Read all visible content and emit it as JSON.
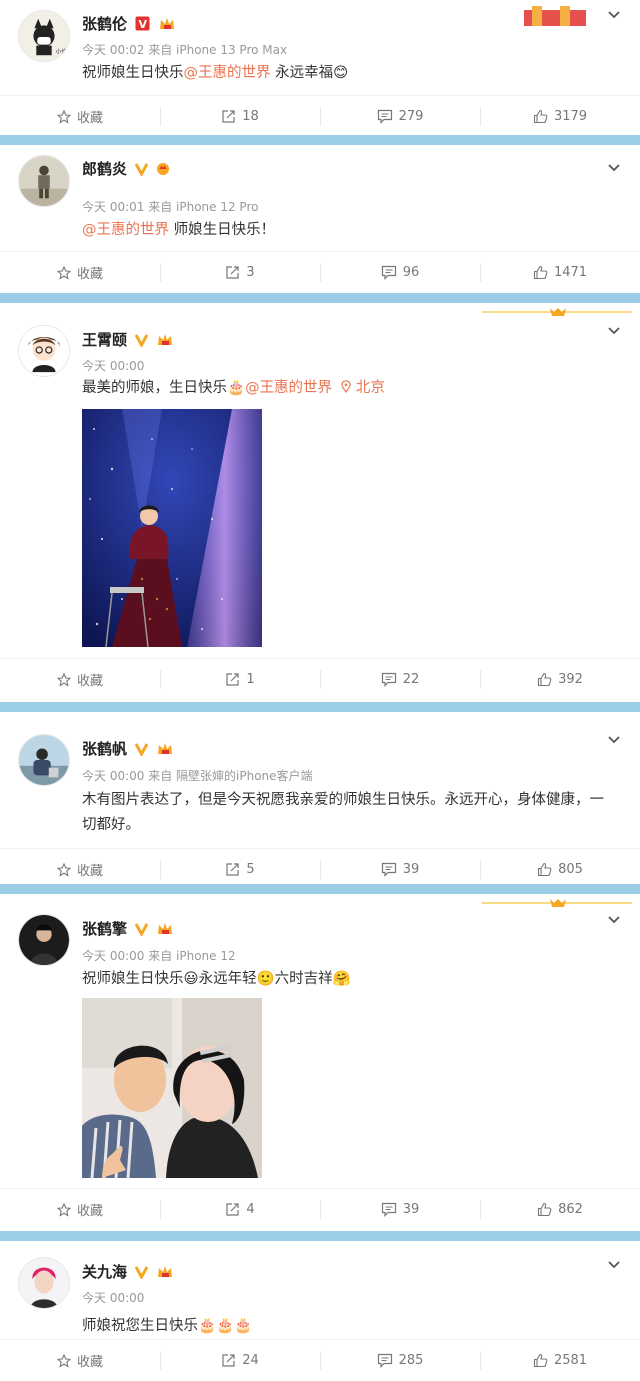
{
  "posts": [
    {
      "name": "张鹤伦",
      "meta": "今天 00:02 来自 iPhone 13 Pro Max",
      "text_pre": "祝师娘生日快乐",
      "mention": "@王惠的世界",
      "text_post": " 永远幸福😊",
      "actions": {
        "fav": "收藏",
        "repost": "18",
        "comment": "279",
        "like": "3179"
      }
    },
    {
      "name": "郎鹤炎",
      "meta": "今天 00:01 来自 iPhone 12 Pro",
      "mention": "@王惠的世界",
      "text_post": " 师娘生日快乐！",
      "actions": {
        "fav": "收藏",
        "repost": "3",
        "comment": "96",
        "like": "1471"
      }
    },
    {
      "name": "王霄颐",
      "meta": "今天 00:00",
      "text_pre": "最美的师娘，生日快乐🎂",
      "mention": "@王惠的世界",
      "location": "北京",
      "actions": {
        "fav": "收藏",
        "repost": "1",
        "comment": "22",
        "like": "392"
      }
    },
    {
      "name": "张鹤帆",
      "meta": "今天 00:00 来自 隔壁张婶的iPhone客户端",
      "text_pre": "木有图片表达了，但是今天祝愿我亲爱的师娘生日快乐。永远开心，身体健康，一切都好。",
      "actions": {
        "fav": "收藏",
        "repost": "5",
        "comment": "39",
        "like": "805"
      }
    },
    {
      "name": "张鹤擎",
      "meta": "今天 00:00 来自 iPhone 12",
      "text_pre": "祝师娘生日快乐😃永远年轻🙂六时吉祥🤗",
      "actions": {
        "fav": "收藏",
        "repost": "4",
        "comment": "39",
        "like": "862"
      }
    },
    {
      "name": "关九海",
      "meta": "今天 00:00",
      "text_pre": "师娘祝您生日快乐🎂🎂🎂",
      "actions": {
        "fav": "收藏",
        "repost": "24",
        "comment": "285",
        "like": "2581"
      }
    }
  ],
  "colors": {
    "mention": "#eb7350",
    "separator": "#9ccde6",
    "badge_v": "#f5a623",
    "badge_red": "#e0332d"
  }
}
